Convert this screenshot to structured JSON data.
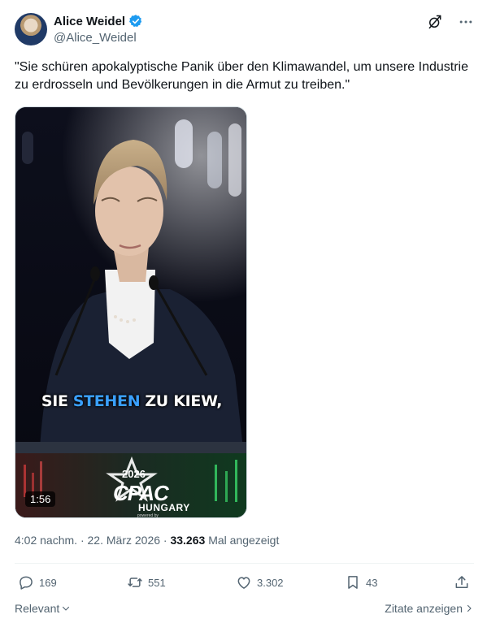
{
  "author": {
    "name": "Alice Weidel",
    "handle": "@Alice_Weidel"
  },
  "tweet": {
    "text": "\"Sie schüren apokalyptische Panik über den Klimawandel, um unsere Industrie zu erdrosseln und Bevölkerungen in die Armut zu treiben.\""
  },
  "video": {
    "caption_words": [
      "SIE",
      "STEHEN",
      "ZU KIEW,"
    ],
    "event_year": "2026",
    "event_name": "CPAC",
    "event_country": "HUNGARY",
    "powered_by": "powered by",
    "duration": "1:56"
  },
  "meta": {
    "time": "4:02 nachm.",
    "date": "22. März 2026",
    "separator": "·",
    "views": "33.263",
    "views_label": "Mal angezeigt"
  },
  "actions": {
    "replies": "169",
    "reposts": "551",
    "likes": "3.302",
    "bookmarks": "43"
  },
  "footer": {
    "sort_label": "Relevant",
    "quotes_label": "Zitate anzeigen"
  },
  "colors": {
    "accent": "#1d9bf0",
    "caption_highlight": "#3aa0ff",
    "secondary_text": "#536471"
  },
  "icons": {
    "verified": "verified-badge-icon",
    "grok": "grok-icon",
    "more": "more-icon",
    "reply": "reply-icon",
    "repost": "repost-icon",
    "like": "like-icon",
    "bookmark": "bookmark-icon",
    "share": "share-icon"
  }
}
